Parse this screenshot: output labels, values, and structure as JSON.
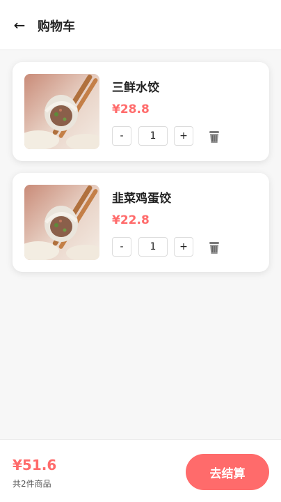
{
  "colors": {
    "accent": "#ff6b6b",
    "header_bg": "#ffffff",
    "page_bg": "#f7f7f7"
  },
  "header": {
    "back_icon": "arrow-left-icon",
    "back_label": "←",
    "title": "购物车"
  },
  "cart": {
    "items": [
      {
        "image_icon": "dumpling-photo",
        "name": "三鲜水饺",
        "price": "¥28.8",
        "minus_label": "-",
        "quantity": "1",
        "plus_label": "+",
        "delete_icon": "trash-icon"
      },
      {
        "image_icon": "dumpling-photo",
        "name": "韭菜鸡蛋饺",
        "price": "¥22.8",
        "minus_label": "-",
        "quantity": "1",
        "plus_label": "+",
        "delete_icon": "trash-icon"
      }
    ]
  },
  "footer": {
    "total": "¥51.6",
    "item_count": "共2件商品",
    "checkout_label": "去结算"
  }
}
